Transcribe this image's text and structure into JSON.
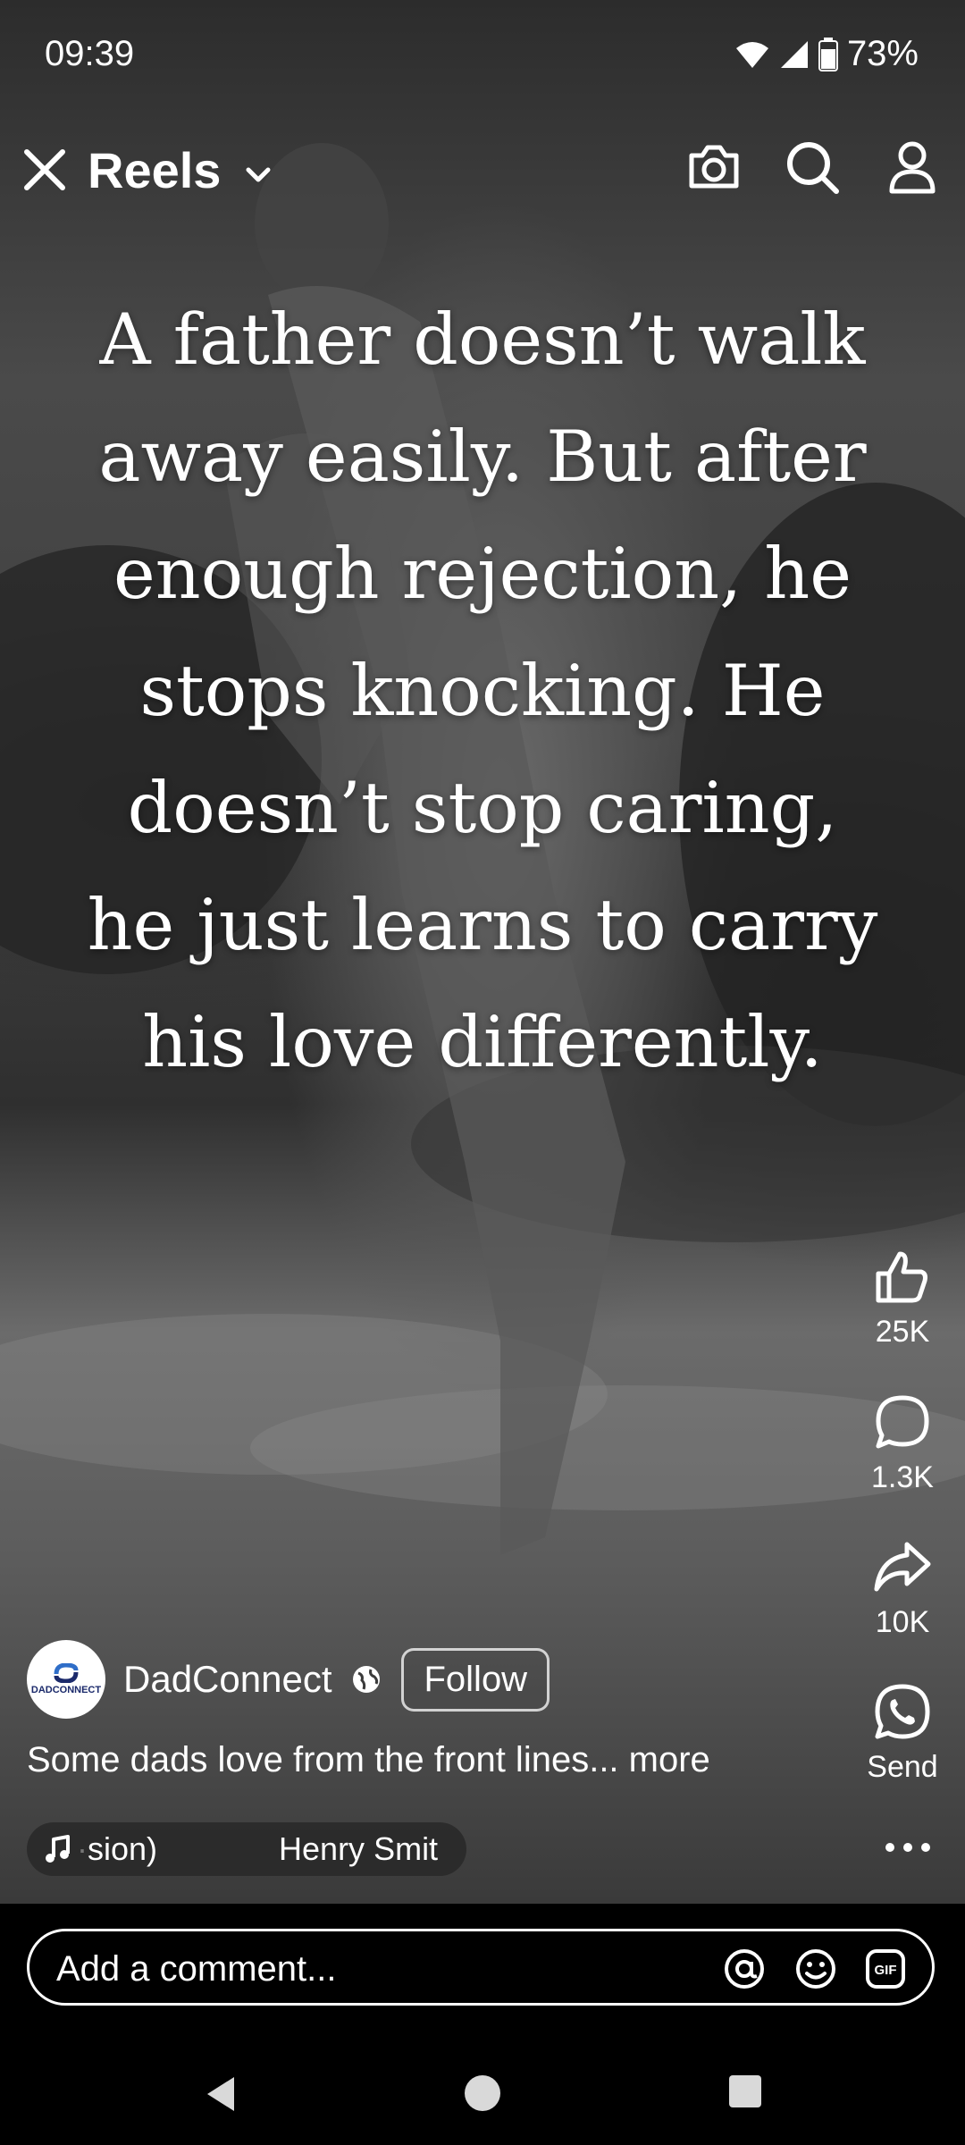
{
  "status": {
    "time": "09:39",
    "battery": "73%"
  },
  "topbar": {
    "title": "Reels"
  },
  "quote": {
    "lines": [
      "A father doesn’t walk",
      "away easily. But after",
      "enough rejection, he",
      "stops knocking. He",
      "doesn’t stop caring,",
      "he just learns to carry",
      "his love differently."
    ]
  },
  "actions": {
    "likes": "25K",
    "comments": "1.3K",
    "shares": "10K",
    "send": "Send"
  },
  "author": {
    "name": "DadConnect",
    "avatar_text": "DADCONNECT",
    "follow": "Follow"
  },
  "caption": "Some dads love from the front lines... more",
  "music": {
    "text_a": "sion)",
    "text_b": "Henry Smit"
  },
  "comment": {
    "placeholder": "Add a comment..."
  }
}
